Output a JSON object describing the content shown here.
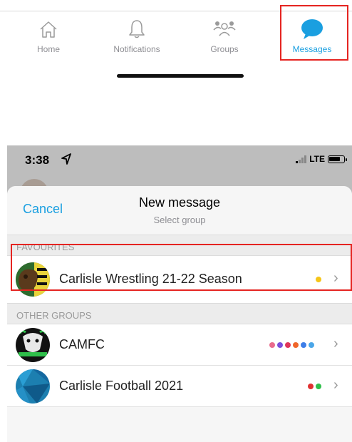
{
  "tabbar": {
    "tabs": [
      {
        "label": "Home",
        "icon": "home-icon"
      },
      {
        "label": "Notifications",
        "icon": "bell-icon"
      },
      {
        "label": "Groups",
        "icon": "groups-icon"
      },
      {
        "label": "Messages",
        "icon": "message-bubble-icon",
        "active": true
      }
    ],
    "active_color": "#1a9fe0"
  },
  "status_bar": {
    "time": "3:38",
    "network": "LTE"
  },
  "sheet": {
    "cancel_label": "Cancel",
    "title": "New message",
    "subtitle": "Select group",
    "sections": [
      {
        "label": "FAVOURITES",
        "groups": [
          {
            "name": "Carlisle Wrestling 21-22 Season",
            "dots": [
              "#f5c518"
            ]
          }
        ]
      },
      {
        "label": "OTHER GROUPS",
        "groups": [
          {
            "name": "CAMFC",
            "dots": [
              "#e96b8d",
              "#7b4fdc",
              "#e0355a",
              "#f0662a",
              "#3d7ee8",
              "#4ba6e8"
            ]
          },
          {
            "name": "Carlisle Football 2021",
            "dots": [
              "#e03131",
              "#2fbf4a"
            ]
          }
        ]
      }
    ]
  },
  "colors": {
    "accent": "#1a9fe0",
    "highlight": "#e52421"
  }
}
